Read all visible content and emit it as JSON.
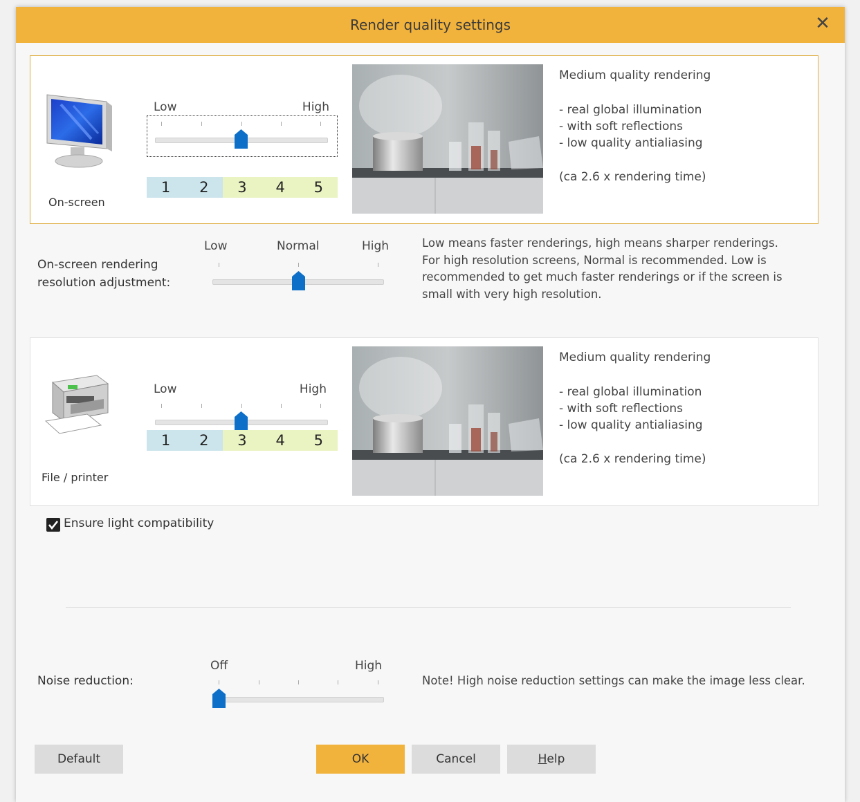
{
  "dialog": {
    "title": "Render quality settings",
    "close_icon": "close-icon"
  },
  "onscreen": {
    "label": "On-screen",
    "icon": "monitor-icon",
    "slider": {
      "low": "Low",
      "high": "High",
      "value": 3,
      "min": 1,
      "max": 5
    },
    "levels": [
      "1",
      "2",
      "3",
      "4",
      "5"
    ],
    "level_colors": [
      "#cce5ec",
      "#cce5ec",
      "#eaf3c2",
      "#eaf3c2",
      "#eaf3c2"
    ],
    "preview_icon": "kitchen-render-preview",
    "description": {
      "title": "Medium quality rendering",
      "features": [
        "- real global illumination",
        "- with soft reflections",
        "- low quality antialiasing"
      ],
      "time": "(ca 2.6 x rendering time)"
    }
  },
  "resolution": {
    "label_line1": "On-screen rendering",
    "label_line2": "resolution adjustment:",
    "low": "Low",
    "normal": "Normal",
    "high": "High",
    "value": "Normal",
    "info": [
      "Low means faster renderings, high means sharper renderings.",
      "For high resolution screens, Normal is recommended. Low is",
      "recommended to get much faster renderings or if the screen is",
      "small with very high resolution."
    ]
  },
  "printer": {
    "label": "File / printer",
    "icon": "printer-icon",
    "slider": {
      "low": "Low",
      "high": "High",
      "value": 3,
      "min": 1,
      "max": 5
    },
    "levels": [
      "1",
      "2",
      "3",
      "4",
      "5"
    ],
    "preview_icon": "kitchen-render-preview",
    "description": {
      "title": "Medium quality rendering",
      "features": [
        "- real global illumination",
        "- with soft reflections",
        "- low quality antialiasing"
      ],
      "time": "(ca 2.6 x rendering time)"
    }
  },
  "light_compat": {
    "label": "Ensure light compatibility",
    "checked": true
  },
  "noise": {
    "label": "Noise reduction:",
    "off": "Off",
    "high": "High",
    "value": 0,
    "note": "Note! High noise reduction settings can make the image less clear."
  },
  "buttons": {
    "default": "Default",
    "ok": "OK",
    "cancel": "Cancel",
    "help_mnemonic": "H",
    "help_rest": "elp"
  },
  "colors": {
    "accent": "#f2b33d",
    "thumb": "#0e6fc9"
  }
}
